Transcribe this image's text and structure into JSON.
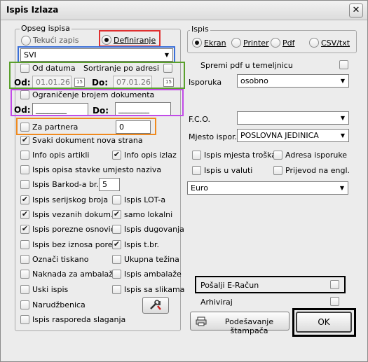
{
  "window": {
    "title": "Ispis Izlaza",
    "close_glyph": "✕"
  },
  "opseg": {
    "legend": "Opseg ispisa",
    "tekuci_label": "Tekući zapis",
    "definiranje_label": "Definiranje",
    "selection_value": "SVI",
    "od_datuma_label": "Od datuma",
    "sortiranje_label": "Sortiranje po adresi",
    "od_label": "Od:",
    "od_value": "01.01.26",
    "do_label": "Do:",
    "do_value": "07.01.26",
    "calendar_glyph": "15",
    "ogranicenje_label": "Ograničenje brojem dokumenta",
    "od2_label": "Od:",
    "od2_value": "________",
    "do2_label": "Do:",
    "do2_value": "________",
    "za_partnera_label": "Za partnera",
    "za_partnera_value": "0"
  },
  "options": {
    "svaki_dokument": "Svaki dokument nova strana",
    "info_opis_artikli": "Info opis artikli",
    "info_opis_izlaz": "Info opis izlaz",
    "ispis_opisa_stavke": "Ispis opisa stavke umjesto naziva",
    "ispis_barkoda": "Ispis Barkod-a br. :",
    "barkod_value": "5",
    "ispis_serijskog": "Ispis serijskog broja",
    "ispis_lot": "Ispis LOT-a",
    "ispis_vezanih": "Ispis vezanih dokum.",
    "samo_lokalni": "samo lokalni",
    "ispis_porezne": "Ispis porezne osnovice",
    "ispis_dugovanja": "Ispis dugovanja",
    "ispis_bez_iznosa": "Ispis bez iznosa poreza",
    "ispis_tbr": "Ispis t.br.",
    "oznaci_tiskano": "Označi tiskano",
    "ukupna_tezina": "Ukupna težina",
    "naknada": "Naknada za ambalažu",
    "ispis_ambalaze": "Ispis ambalaže",
    "uski_ispis": "Uski ispis",
    "ispis_sa_slikama": "Ispis sa slikama",
    "narudzbenica": "Narudžbenica",
    "ispis_rasporeda": "Ispis rasporeda slaganja"
  },
  "ispis": {
    "legend": "Ispis",
    "ekran": "Ekran",
    "printer": "Printer",
    "pdf": "Pdf",
    "csv": "CSV/txt",
    "spremi_pdf": "Spremi pdf u temeljnicu",
    "isporuka_label": "Isporuka",
    "isporuka_value": "osobno",
    "fco_label": "F.C.O.",
    "fco_value": "",
    "mjesto_label": "Mjesto ispor.",
    "mjesto_value": "POSLOVNA JEDINICA",
    "ispis_mjesta_troska": "Ispis mjesta troška",
    "adresa_isporuke": "Adresa isporuke",
    "ispis_u_valuti": "Ispis u valuti",
    "prijevod": "Prijevod na engl.",
    "valuta_value": "Euro",
    "posalji_eracun": "Pošalji E-Račun",
    "arhiviraj": "Arhiviraj",
    "podesavanje": "Podešavanje štampača",
    "ok": "OK"
  },
  "colors": {
    "red": "#e03030",
    "blue": "#3a6fd8",
    "green": "#5aa02c",
    "purple": "#c24ae8",
    "orange": "#f08a1e",
    "black": "#000000"
  }
}
